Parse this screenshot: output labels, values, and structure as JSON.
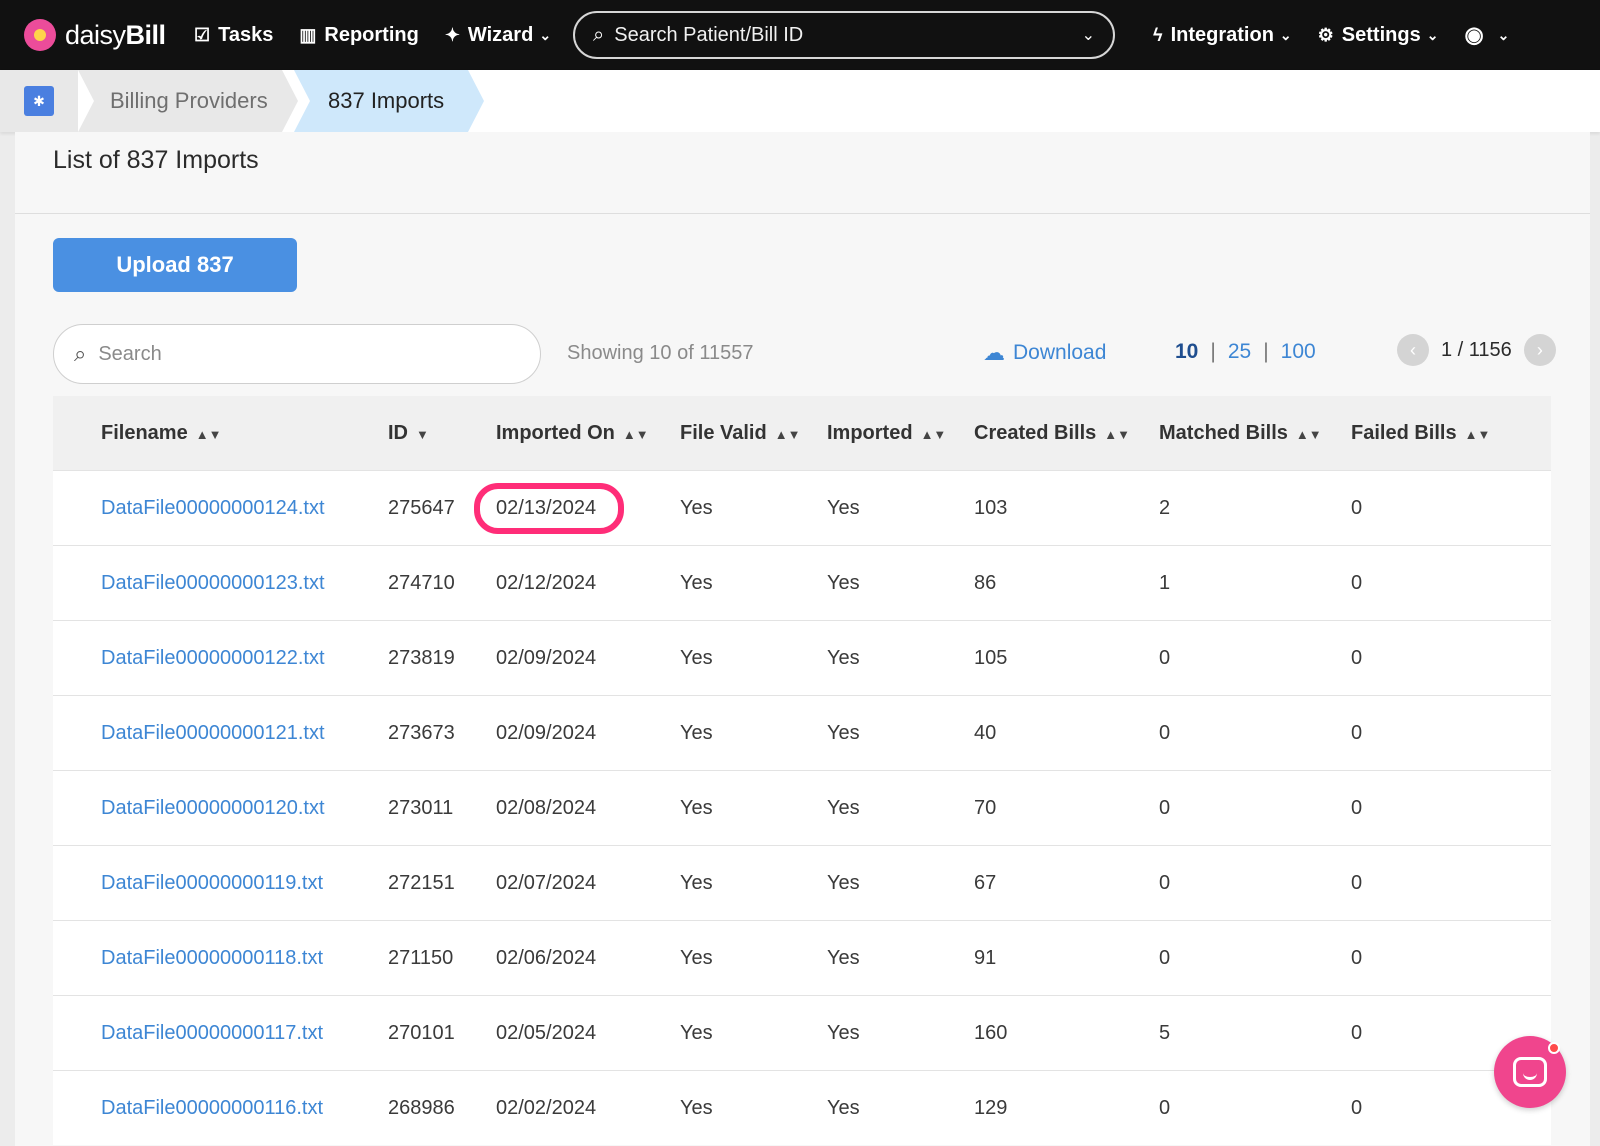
{
  "nav": {
    "brand_light": "daisy",
    "brand_bold": "Bill",
    "tasks": "Tasks",
    "reporting": "Reporting",
    "wizard": "Wizard",
    "search_placeholder": "Search Patient/Bill ID",
    "integration": "Integration",
    "settings": "Settings"
  },
  "breadcrumb": {
    "home_icon": "billing-provider-icon",
    "items": [
      "Billing Providers",
      "837 Imports"
    ]
  },
  "page": {
    "title": "List of 837 Imports",
    "upload_label": "Upload 837",
    "search_placeholder": "Search",
    "showing": "Showing 10 of 11557",
    "download_label": "Download",
    "page_sizes": [
      "10",
      "25",
      "100"
    ],
    "selected_page_size": "10",
    "pagination": "1 / 1156"
  },
  "table": {
    "headers": [
      "Filename",
      "ID",
      "Imported On",
      "File Valid",
      "Imported",
      "Created Bills",
      "Matched Bills",
      "Failed Bills"
    ],
    "highlighted_cell": "rows.0.imported_on",
    "rows": [
      {
        "filename": "DataFile00000000124.txt",
        "id": "275647",
        "imported_on": "02/13/2024",
        "file_valid": "Yes",
        "imported": "Yes",
        "created": "103",
        "matched": "2",
        "failed": "0"
      },
      {
        "filename": "DataFile00000000123.txt",
        "id": "274710",
        "imported_on": "02/12/2024",
        "file_valid": "Yes",
        "imported": "Yes",
        "created": "86",
        "matched": "1",
        "failed": "0"
      },
      {
        "filename": "DataFile00000000122.txt",
        "id": "273819",
        "imported_on": "02/09/2024",
        "file_valid": "Yes",
        "imported": "Yes",
        "created": "105",
        "matched": "0",
        "failed": "0"
      },
      {
        "filename": "DataFile00000000121.txt",
        "id": "273673",
        "imported_on": "02/09/2024",
        "file_valid": "Yes",
        "imported": "Yes",
        "created": "40",
        "matched": "0",
        "failed": "0"
      },
      {
        "filename": "DataFile00000000120.txt",
        "id": "273011",
        "imported_on": "02/08/2024",
        "file_valid": "Yes",
        "imported": "Yes",
        "created": "70",
        "matched": "0",
        "failed": "0"
      },
      {
        "filename": "DataFile00000000119.txt",
        "id": "272151",
        "imported_on": "02/07/2024",
        "file_valid": "Yes",
        "imported": "Yes",
        "created": "67",
        "matched": "0",
        "failed": "0"
      },
      {
        "filename": "DataFile00000000118.txt",
        "id": "271150",
        "imported_on": "02/06/2024",
        "file_valid": "Yes",
        "imported": "Yes",
        "created": "91",
        "matched": "0",
        "failed": "0"
      },
      {
        "filename": "DataFile00000000117.txt",
        "id": "270101",
        "imported_on": "02/05/2024",
        "file_valid": "Yes",
        "imported": "Yes",
        "created": "160",
        "matched": "5",
        "failed": "0"
      },
      {
        "filename": "DataFile00000000116.txt",
        "id": "268986",
        "imported_on": "02/02/2024",
        "file_valid": "Yes",
        "imported": "Yes",
        "created": "129",
        "matched": "0",
        "failed": "0"
      }
    ]
  },
  "colors": {
    "nav_bg": "#111111",
    "accent_blue": "#4a90e2",
    "link_blue": "#3d86d4",
    "highlight_ring": "#ff2d78",
    "chat_pink": "#f0458d"
  }
}
